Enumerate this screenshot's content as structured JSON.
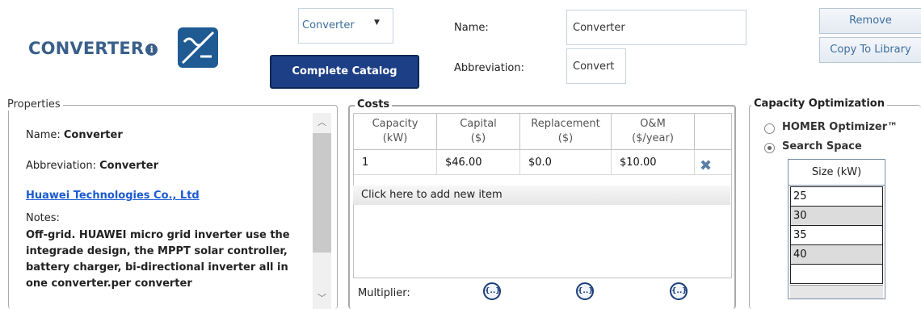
{
  "header": {
    "title": "CONVERTER",
    "info_glyph": "i",
    "logo_icon": "converter-logo-icon",
    "type_select": "Converter",
    "catalog_button": "Complete Catalog",
    "name_label": "Name:",
    "name_value": "Converter",
    "abbr_label": "Abbreviation:",
    "abbr_value": "Convert",
    "remove_button": "Remove",
    "copy_button": "Copy To Library",
    "brand_color": "#1f5a93",
    "title_color": "#3a5f8a"
  },
  "properties": {
    "legend": "Properties",
    "name_label": "Name: ",
    "name_value": "Converter",
    "abbr_label": "Abbreviation: ",
    "abbr_value": "Converter",
    "manufacturer": "Huawei Technologies Co., Ltd",
    "notes_label": "Notes:",
    "notes_text": "Off-grid. HUAWEI micro grid inverter use the integrade design, the MPPT solar controller, battery charger, bi-directional inverter all in one converter.per converter"
  },
  "costs": {
    "legend": "Costs",
    "columns": [
      {
        "line1": "Capacity",
        "line2": "(kW)"
      },
      {
        "line1": "Capital",
        "line2": "($)"
      },
      {
        "line1": "Replacement",
        "line2": "($)"
      },
      {
        "line1": "O&M",
        "line2": "($/year)"
      }
    ],
    "rows": [
      {
        "capacity": "1",
        "capital": "$46.00",
        "replacement": "$0.0",
        "om": "$10.00"
      }
    ],
    "add_item": "Click here to add new item",
    "multiplier_label": "Multiplier:",
    "multiplier_glyph": "{..}"
  },
  "capacity_optimization": {
    "legend": "Capacity Optimization",
    "options": [
      {
        "label": "HOMER Optimizer™",
        "selected": false
      },
      {
        "label": "Search Space",
        "selected": true
      }
    ],
    "size_header": "Size (kW)",
    "sizes": [
      "25",
      "30",
      "35",
      "40",
      ""
    ]
  }
}
